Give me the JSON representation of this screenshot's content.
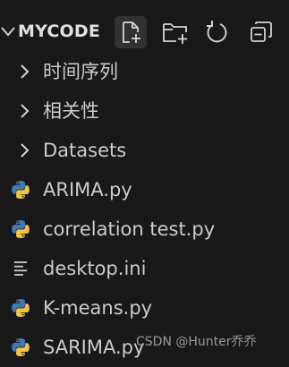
{
  "explorer": {
    "title": "MYCODE",
    "actions": [
      {
        "icon": "new-file-icon",
        "label": "New File"
      },
      {
        "icon": "new-folder-icon",
        "label": "New Folder"
      },
      {
        "icon": "refresh-icon",
        "label": "Refresh Explorer"
      },
      {
        "icon": "collapse-all-icon",
        "label": "Collapse Folders in Explorer"
      }
    ],
    "items": [
      {
        "type": "folder",
        "label": "时间序列",
        "icon": "chevron-right-icon"
      },
      {
        "type": "folder",
        "label": "相关性",
        "icon": "chevron-right-icon"
      },
      {
        "type": "folder",
        "label": "Datasets",
        "icon": "chevron-right-icon"
      },
      {
        "type": "file",
        "label": "ARIMA.py",
        "icon": "python-icon"
      },
      {
        "type": "file",
        "label": "correlation test.py",
        "icon": "python-icon"
      },
      {
        "type": "file",
        "label": "desktop.ini",
        "icon": "settings-file-icon"
      },
      {
        "type": "file",
        "label": "K-means.py",
        "icon": "python-icon"
      },
      {
        "type": "file",
        "label": "SARIMA.py",
        "icon": "python-icon"
      }
    ]
  },
  "watermark": "CSDN @Hunter乔乔",
  "colors": {
    "background": "#181818",
    "text": "#cccccc",
    "python_blue": "#3d7ab3",
    "python_yellow": "#f5c343",
    "active_button_bg": "#313131"
  }
}
